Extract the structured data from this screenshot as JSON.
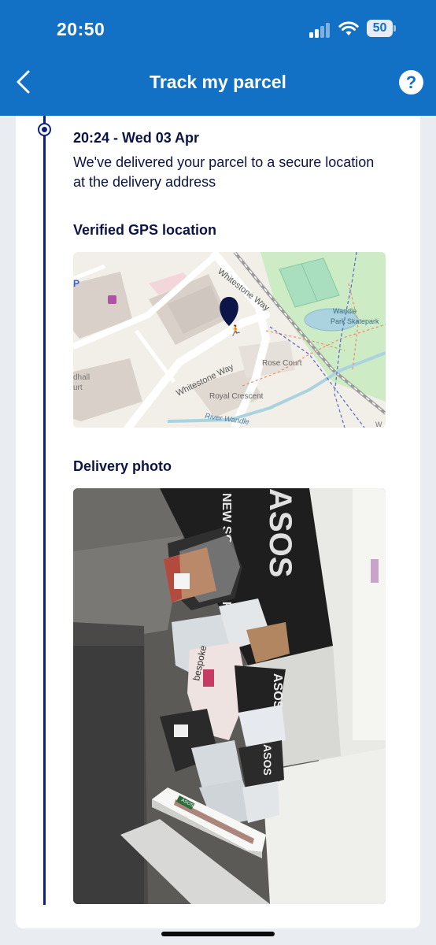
{
  "status_bar": {
    "time": "20:50",
    "battery": "50",
    "icons": [
      "signal-icon",
      "wifi-icon",
      "battery-icon"
    ]
  },
  "header": {
    "title": "Track my parcel",
    "back_icon": "chevron-left-icon",
    "help_label": "?"
  },
  "colors": {
    "brand": "#1271c5",
    "timeline": "#0b1f8a",
    "text": "#0c1446",
    "pin": "#0b1548"
  },
  "event": {
    "time": "20:24 - Wed 03 Apr",
    "description": "We've delivered your parcel to a secure location at the delivery address"
  },
  "map_section": {
    "title": "Verified GPS location",
    "labels": {
      "road_upper": "Whitestone Way",
      "road_lower": "Whitestone Way",
      "rose_court": "Rose Court",
      "royal_crescent": "Royal Crescent",
      "river": "River Wandle",
      "park_line1": "Wandle",
      "park_line2": "Park Skatepark",
      "partial_line1": "dhall",
      "partial_line2": "urt",
      "partial_p": "P",
      "partial_w": "W"
    }
  },
  "photo_section": {
    "title": "Delivery photo",
    "wall_text": "NEW SOUTH QUARTER",
    "brand_text": "ASOS",
    "bag_text": "bespoke",
    "box_label": "ASOS"
  }
}
